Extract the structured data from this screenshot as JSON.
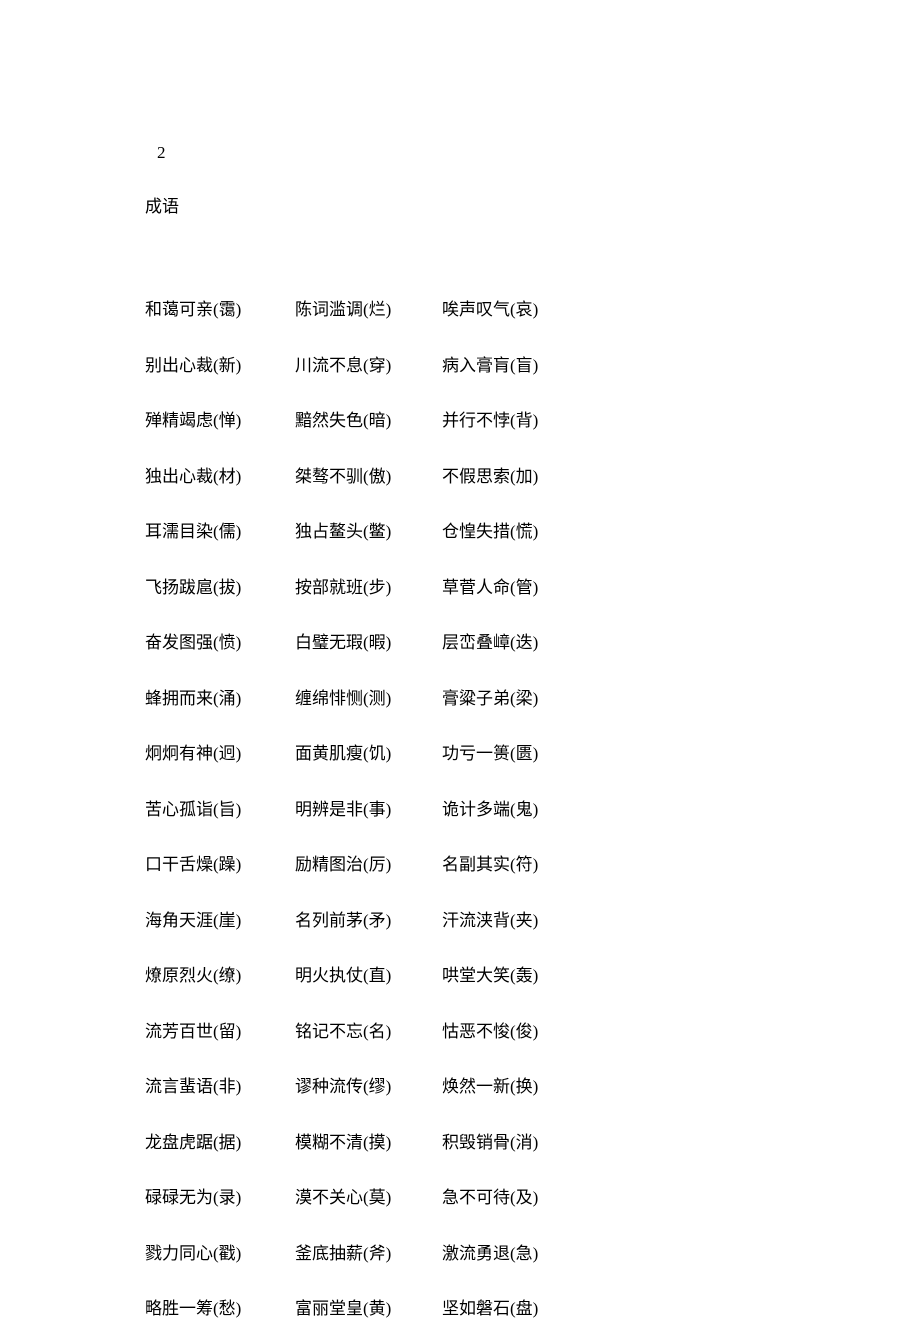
{
  "page_number": "2",
  "section_title": "成语",
  "rows": [
    [
      "和蔼可亲(霭)",
      "陈词滥调(烂)",
      "唉声叹气(哀)"
    ],
    [
      "别出心裁(新)",
      "川流不息(穿)",
      "病入膏肓(盲)"
    ],
    [
      "殚精竭虑(惮)",
      "黯然失色(暗)",
      "并行不悖(背)"
    ],
    [
      "独出心裁(材)",
      "桀骜不驯(傲)",
      "不假思索(加)"
    ],
    [
      "耳濡目染(儒)",
      "独占鳌头(鳖)",
      "仓惶失措(慌)"
    ],
    [
      "飞扬跋扈(拔)",
      "按部就班(步)",
      "草菅人命(管)"
    ],
    [
      "奋发图强(愤)",
      "白璧无瑕(暇)",
      "层峦叠嶂(迭)"
    ],
    [
      "蜂拥而来(涌)",
      "缠绵悱恻(测)",
      "膏粱子弟(梁)"
    ],
    [
      "炯炯有神(迥)",
      "面黄肌瘦(饥)",
      "功亏一篑(匮)"
    ],
    [
      "苦心孤诣(旨)",
      "明辨是非(事)",
      "诡计多端(鬼)"
    ],
    [
      "口干舌燥(躁)",
      "励精图治(厉)",
      "名副其实(符)"
    ],
    [
      "海角天涯(崖)",
      "名列前茅(矛)",
      "汗流浃背(夹)"
    ],
    [
      "燎原烈火(缭)",
      "明火执仗(直)",
      "哄堂大笑(轰)"
    ],
    [
      "流芳百世(留)",
      "铭记不忘(名)",
      "怙恶不悛(俊)"
    ],
    [
      "流言蜚语(非)",
      "谬种流传(缪)",
      "焕然一新(换)"
    ],
    [
      "龙盘虎踞(据)",
      "模糊不清(摸)",
      "积毁销骨(消)"
    ],
    [
      "碌碌无为(录)",
      "漠不关心(莫)",
      "急不可待(及)"
    ],
    [
      "戮力同心(戳)",
      "釜底抽薪(斧)",
      "激流勇退(急)"
    ],
    [
      "略胜一筹(愁)",
      "富丽堂皇(黄)",
      "坚如磐石(盘)"
    ]
  ]
}
